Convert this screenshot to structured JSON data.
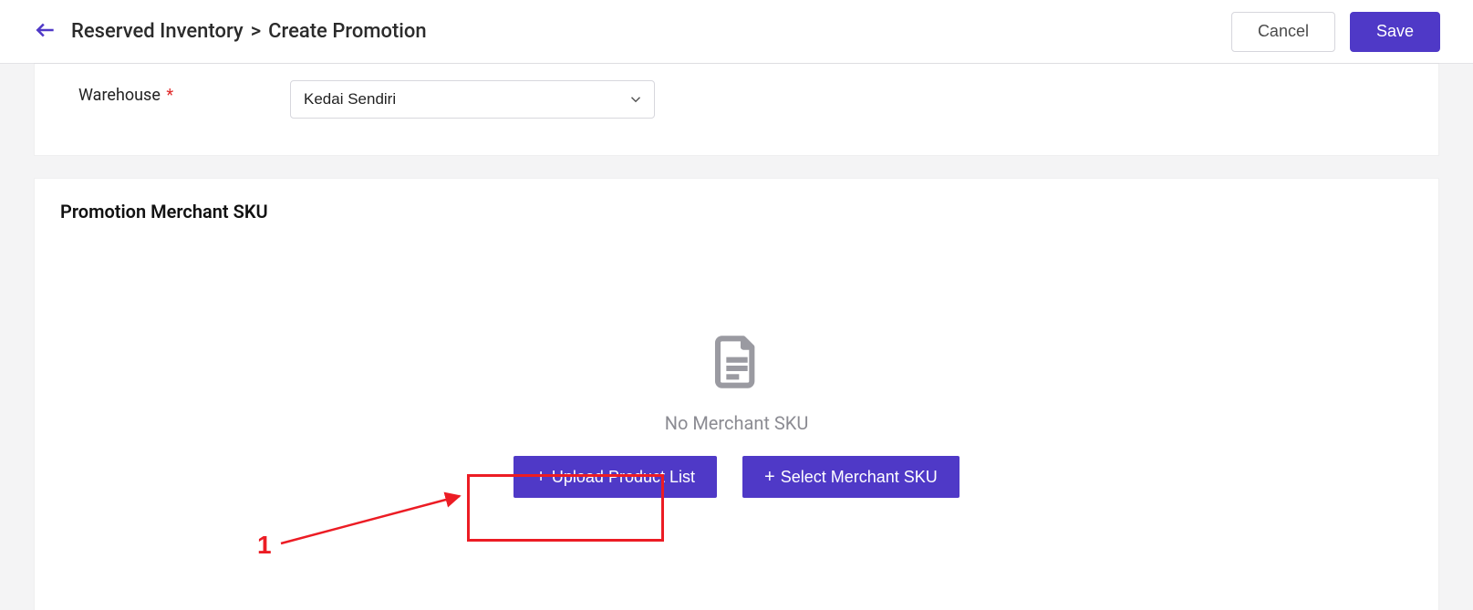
{
  "header": {
    "breadcrumb_prev": "Reserved Inventory",
    "breadcrumb_sep": ">",
    "breadcrumb_curr": "Create Promotion",
    "cancel_label": "Cancel",
    "save_label": "Save"
  },
  "form": {
    "warehouse_label": "Warehouse",
    "required_mark": "*",
    "warehouse_value": "Kedai Sendiri"
  },
  "sku": {
    "card_title": "Promotion Merchant SKU",
    "empty_text": "No Merchant SKU",
    "upload_label": "Upload Product List",
    "select_label": "Select Merchant SKU",
    "plus": "+"
  },
  "annot": {
    "number": "1"
  },
  "colors": {
    "accent": "#4f39c7",
    "annotation": "#ec1c24"
  }
}
